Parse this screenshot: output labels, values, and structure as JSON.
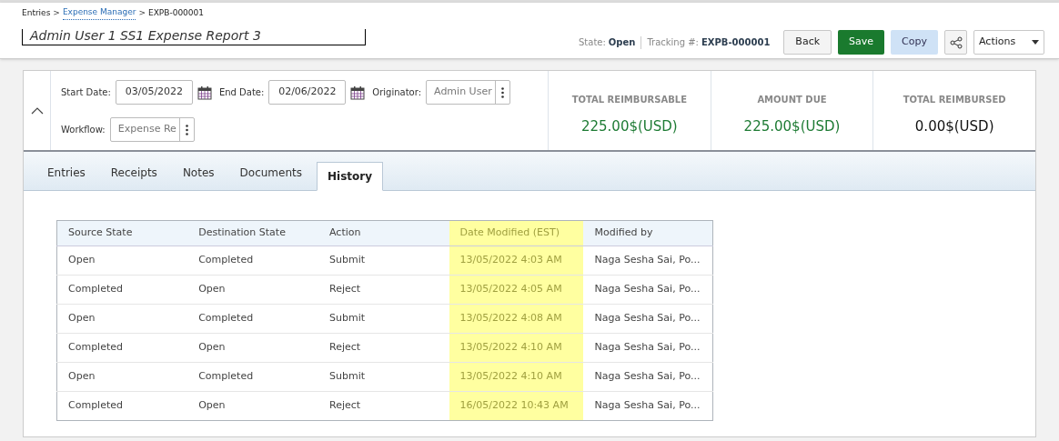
{
  "breadcrumb": [
    {
      "label": "Entries",
      "link": false,
      "kind": "crumb"
    },
    {
      "label": ">",
      "kind": "separator"
    },
    {
      "label": "Expense Manager",
      "link": true,
      "kind": "crumb"
    },
    {
      "label": ">",
      "kind": "separator"
    },
    {
      "label": "EXPB-000001",
      "link": false,
      "kind": "crumb"
    }
  ],
  "title": "Admin User 1 SS1 Expense Report 3",
  "status": {
    "state_label": "State:",
    "state": "Open",
    "tracking_label": "Tracking #:",
    "tracking": "EXPB-000001"
  },
  "buttons": [
    {
      "label": "Back",
      "kind": "default"
    },
    {
      "label": "Save",
      "kind": "primary"
    },
    {
      "label": "Copy",
      "kind": "secondary"
    },
    {
      "kind": "share"
    },
    {
      "label": "Actions",
      "kind": "dropdown"
    }
  ],
  "filters": [
    {
      "label": "Start Date:",
      "value": "03/05/2022",
      "kind": "date"
    },
    {
      "label": "End Date:",
      "value": "02/06/2022",
      "kind": "date"
    },
    {
      "label": "Originator:",
      "value": "Admin User",
      "kind": "lookup"
    },
    {
      "label": "Workflow:",
      "value": "Expense Re",
      "kind": "lookup"
    }
  ],
  "totals": [
    {
      "label": "TOTAL REIMBURSABLE",
      "value": "225.00$(USD)",
      "color": "#1e7b34"
    },
    {
      "label": "AMOUNT DUE",
      "value": "225.00$(USD)",
      "color": "#1e7b34"
    },
    {
      "label": "TOTAL REIMBURSED",
      "value": "0.00$(USD)",
      "color": "#111111"
    }
  ],
  "tabs": [
    {
      "label": "Entries",
      "selected": false
    },
    {
      "label": "Receipts",
      "selected": false
    },
    {
      "label": "Notes",
      "selected": false
    },
    {
      "label": "Documents",
      "selected": false
    },
    {
      "label": "History",
      "selected": true
    }
  ],
  "table": {
    "columns": [
      {
        "label": "Source State",
        "highlighted": false
      },
      {
        "label": "Destination State",
        "highlighted": false
      },
      {
        "label": "Action",
        "highlighted": false
      },
      {
        "label": "Date Modified (EST)",
        "highlighted": true
      },
      {
        "label": "Modified by",
        "highlighted": false
      }
    ],
    "rows": [
      [
        "Open",
        "Completed",
        "Submit",
        "13/05/2022 4:03 AM",
        "Naga Sesha Sai, Po..."
      ],
      [
        "Completed",
        "Open",
        "Reject",
        "13/05/2022 4:05 AM",
        "Naga Sesha Sai, Po..."
      ],
      [
        "Open",
        "Completed",
        "Submit",
        "13/05/2022 4:08 AM",
        "Naga Sesha Sai, Po..."
      ],
      [
        "Completed",
        "Open",
        "Reject",
        "13/05/2022 4:10 AM",
        "Naga Sesha Sai, Po..."
      ],
      [
        "Open",
        "Completed",
        "Submit",
        "13/05/2022 4:10 AM",
        "Naga Sesha Sai, Po..."
      ],
      [
        "Completed",
        "Open",
        "Reject",
        "16/05/2022 10:43 AM",
        "Naga Sesha Sai, Po..."
      ]
    ]
  }
}
